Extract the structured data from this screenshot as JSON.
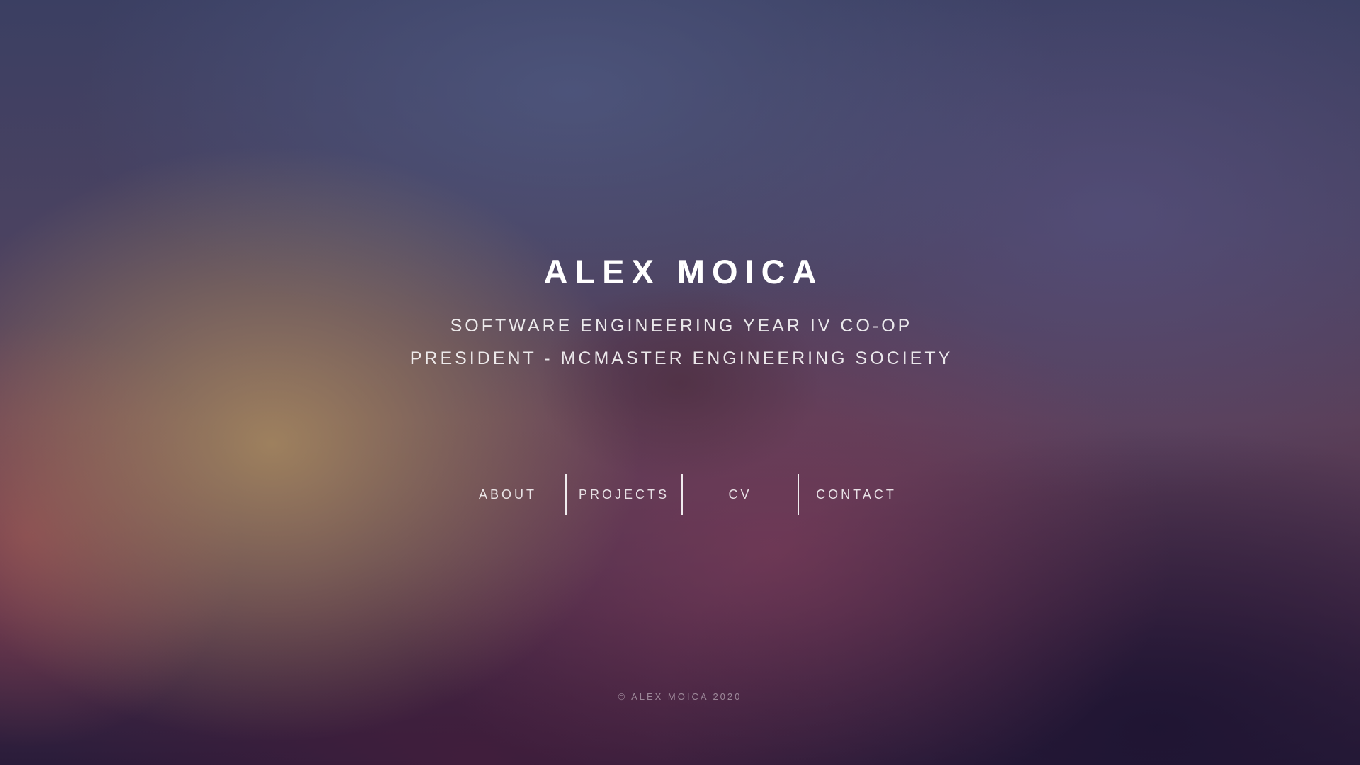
{
  "header": {
    "name": "ALEX MOICA",
    "subtitle_line1": "SOFTWARE ENGINEERING YEAR IV CO-OP",
    "subtitle_line2": "PRESIDENT - MCMASTER ENGINEERING SOCIETY"
  },
  "nav": {
    "items": [
      {
        "label": "ABOUT"
      },
      {
        "label": "PROJECTS"
      },
      {
        "label": "CV"
      },
      {
        "label": "CONTACT"
      }
    ]
  },
  "footer": {
    "copyright": "© ALEX MOICA 2020"
  },
  "colors": {
    "text": "#ffffff",
    "background_top": "#3b3f62",
    "background_bottom": "#2a1c3a"
  }
}
